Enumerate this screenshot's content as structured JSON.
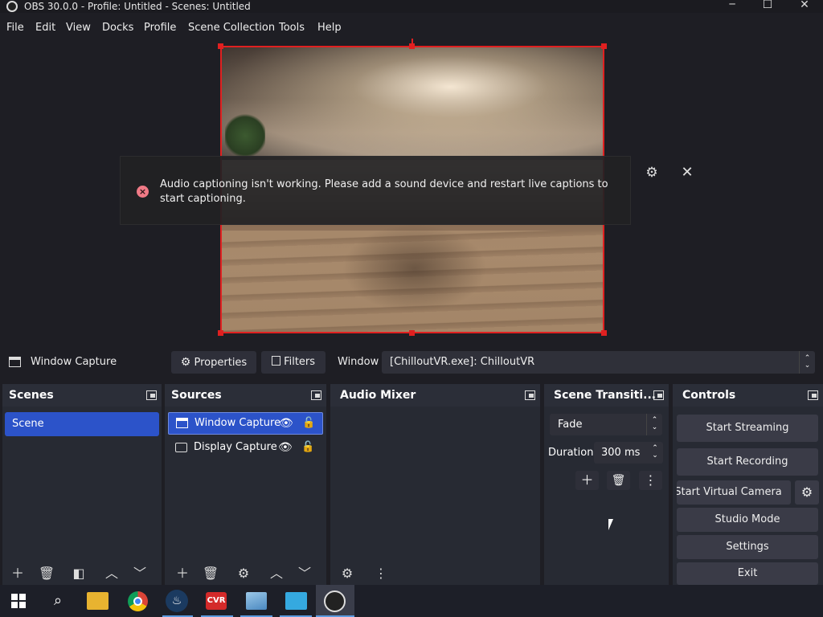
{
  "window": {
    "title": "OBS 30.0.0 - Profile: Untitled - Scenes: Untitled",
    "controls": {
      "minimize": "─",
      "maximize": "☐",
      "close": "✕"
    }
  },
  "menu": [
    "File",
    "Edit",
    "View",
    "Docks",
    "Profile",
    "Scene Collection",
    "Tools",
    "Help"
  ],
  "toast": {
    "message": "Audio captioning isn't working. Please add a sound device and restart live captions to start captioning.",
    "icon": "error-icon"
  },
  "source_bar": {
    "selected_source": "Window Capture",
    "properties_label": "Properties",
    "filters_label": "Filters",
    "window_label": "Window",
    "window_value": "[ChilloutVR.exe]: ChilloutVR"
  },
  "docks": {
    "scenes": {
      "title": "Scenes",
      "items": [
        "Scene"
      ]
    },
    "sources": {
      "title": "Sources",
      "items": [
        "Window Capture",
        "Display Capture"
      ]
    },
    "audio_mixer": {
      "title": "Audio Mixer"
    },
    "transitions": {
      "title": "Scene Transiti...",
      "transition": "Fade",
      "duration_label": "Duration",
      "duration_value": "300 ms"
    },
    "controls": {
      "title": "Controls",
      "start_streaming": "Start Streaming",
      "start_recording": "Start Recording",
      "start_virtual_camera": "Start Virtual Camera",
      "studio_mode": "Studio Mode",
      "settings": "Settings",
      "exit": "Exit"
    }
  },
  "colors": {
    "accent_selected": "#2c53c9",
    "preview_border": "#e02020",
    "panel_bg": "#272a33",
    "toast_error": "#f07a86"
  },
  "taskbar": {
    "icons": [
      "windows-start-icon",
      "search-icon",
      "file-explorer-icon",
      "chrome-icon",
      "steam-icon",
      "chilloutvr-icon",
      "resource-monitor-icon",
      "display-icon",
      "obs-icon"
    ]
  }
}
